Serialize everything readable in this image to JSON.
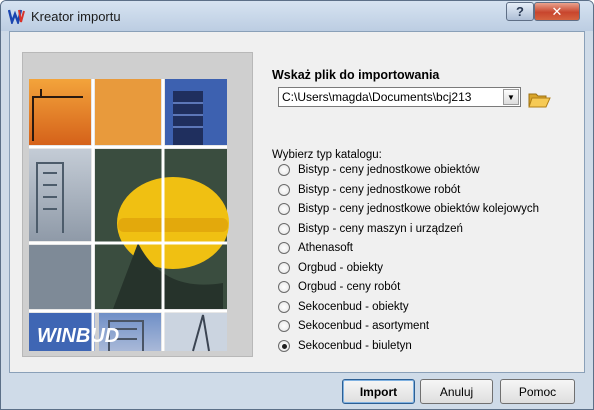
{
  "window": {
    "title": "Kreator importu",
    "help_label": "?",
    "close_label": "✕"
  },
  "logo": {
    "text": "WINBUD"
  },
  "file": {
    "label": "Wskaż plik do importowania",
    "path": "C:\\Users\\magda\\Documents\\bcj213",
    "dropdown_icon": "chevron-down-icon",
    "folder_icon": "folder-open-icon"
  },
  "catalog": {
    "label": "Wybierz typ katalogu:",
    "options": [
      {
        "label": "Bistyp - ceny jednostkowe obiektów",
        "checked": false
      },
      {
        "label": "Bistyp - ceny jednostkowe robót",
        "checked": false
      },
      {
        "label": "Bistyp - ceny jednostkowe obiektów kolejowych",
        "checked": false
      },
      {
        "label": "Bistyp - ceny maszyn i urządzeń",
        "checked": false
      },
      {
        "label": "Athenasoft",
        "checked": false
      },
      {
        "label": "Orgbud - obiekty",
        "checked": false
      },
      {
        "label": "Orgbud - ceny robót",
        "checked": false
      },
      {
        "label": "Sekocenbud - obiekty",
        "checked": false
      },
      {
        "label": "Sekocenbud - asortyment",
        "checked": false
      },
      {
        "label": "Sekocenbud - biuletyn",
        "checked": true
      }
    ]
  },
  "buttons": {
    "import": "Import",
    "cancel": "Anuluj",
    "help": "Pomoc"
  },
  "colors": {
    "titlebar": "#c9d8ea",
    "close": "#c8452d",
    "logo_bg": "#3f66b4"
  }
}
